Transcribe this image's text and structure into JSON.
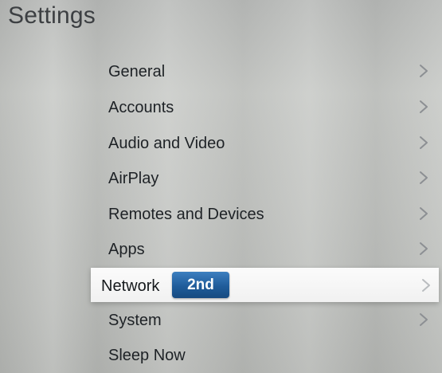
{
  "page": {
    "title": "Settings"
  },
  "menu": {
    "items": [
      {
        "label": "General",
        "chevron": true,
        "icon": "chevron-right-icon"
      },
      {
        "label": "Accounts",
        "chevron": true,
        "icon": "chevron-right-icon"
      },
      {
        "label": "Audio and Video",
        "chevron": true,
        "icon": "chevron-right-icon"
      },
      {
        "label": "AirPlay",
        "chevron": true,
        "icon": "chevron-right-icon"
      },
      {
        "label": "Remotes and Devices",
        "chevron": true,
        "icon": "chevron-right-icon"
      },
      {
        "label": "Apps",
        "chevron": true,
        "icon": "chevron-right-icon"
      },
      {
        "label": "Network",
        "chevron": true,
        "icon": "chevron-right-icon",
        "focused": true,
        "badge": "2nd"
      },
      {
        "label": "System",
        "chevron": true,
        "icon": "chevron-right-icon"
      },
      {
        "label": "Sleep Now",
        "chevron": false
      }
    ]
  },
  "colors": {
    "badge_background": "#1f5c9a",
    "badge_text": "#ffffff",
    "focus_background": "#f6f6f6"
  }
}
